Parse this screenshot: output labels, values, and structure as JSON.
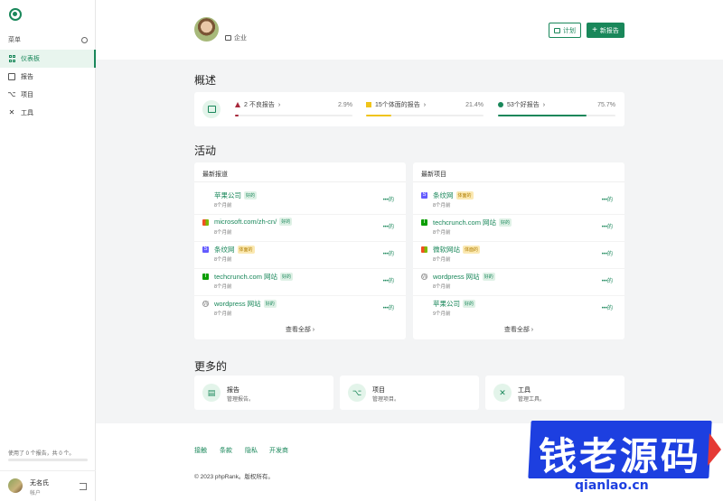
{
  "sidebar": {
    "menu_label": "菜单",
    "items": [
      {
        "label": "仪表板",
        "active": true
      },
      {
        "label": "报告"
      },
      {
        "label": "项目"
      },
      {
        "label": "工具"
      }
    ],
    "usage": "使用了 0 个报告，共 0 个。",
    "user": {
      "name": "无名氏",
      "role": "帐户"
    }
  },
  "header": {
    "org": "企业",
    "plan_label": "计划",
    "new_report_label": "新报告"
  },
  "overview": {
    "title": "概述",
    "stats": [
      {
        "label": "2 不良报告",
        "value": "2.9%",
        "fill": 0.029,
        "color": "#a7283b"
      },
      {
        "label": "15个体面的报告",
        "value": "21.4%",
        "fill": 0.214,
        "color": "#f0c419"
      },
      {
        "label": "53个好报告",
        "value": "75.7%",
        "fill": 0.757,
        "color": "#19875a"
      }
    ]
  },
  "activity": {
    "title": "活动",
    "left": {
      "header": "最新报道",
      "items": [
        {
          "title": "苹果公司",
          "badge": "好的",
          "badge_type": "good",
          "time": "8个月前",
          "icon": "apple-icon"
        },
        {
          "title": "microsoft.com/zh-cn/",
          "badge": "好的",
          "badge_type": "good",
          "time": "8个月前",
          "icon": "microsoft-icon"
        },
        {
          "title": "条纹网",
          "badge": "体面的",
          "badge_type": "bad",
          "time": "8个月前",
          "icon": "stripe-icon"
        },
        {
          "title": "techcrunch.com 网站",
          "badge": "好的",
          "badge_type": "good",
          "time": "8个月前",
          "icon": "techcrunch-icon"
        },
        {
          "title": "wordpress 网站",
          "badge": "好的",
          "badge_type": "good",
          "time": "8个月前",
          "icon": "wordpress-icon"
        }
      ],
      "more": "•••的",
      "view_all": "查看全部"
    },
    "right": {
      "header": "最新项目",
      "items": [
        {
          "title": "条纹网",
          "badge": "体面的",
          "badge_type": "bad",
          "time": "8个月前",
          "icon": "stripe-icon"
        },
        {
          "title": "techcrunch.com 网站",
          "badge": "好的",
          "badge_type": "good",
          "time": "8个月前",
          "icon": "techcrunch-icon"
        },
        {
          "title": "微软网站",
          "badge": "体面的",
          "badge_type": "bad",
          "time": "8个月前",
          "icon": "microsoft-icon"
        },
        {
          "title": "wordpress 网站",
          "badge": "好的",
          "badge_type": "good",
          "time": "8个月前",
          "icon": "wordpress-icon"
        },
        {
          "title": "苹果公司",
          "badge": "好的",
          "badge_type": "good",
          "time": "9个月前",
          "icon": "apple-icon"
        }
      ],
      "more": "•••的",
      "view_all": "查看全部"
    }
  },
  "more": {
    "title": "更多的",
    "cards": [
      {
        "title": "报告",
        "desc": "管理报告。",
        "icon": "report-icon"
      },
      {
        "title": "项目",
        "desc": "管理项目。",
        "icon": "project-icon"
      },
      {
        "title": "工具",
        "desc": "管理工具。",
        "icon": "tools-icon"
      }
    ]
  },
  "footer": {
    "links": [
      "接触",
      "条款",
      "隐私",
      "开发商"
    ],
    "copyright": "© 2023 phpRank。版权所有。"
  },
  "watermark": {
    "text": "钱老源码",
    "url": "qianlao.cn"
  }
}
